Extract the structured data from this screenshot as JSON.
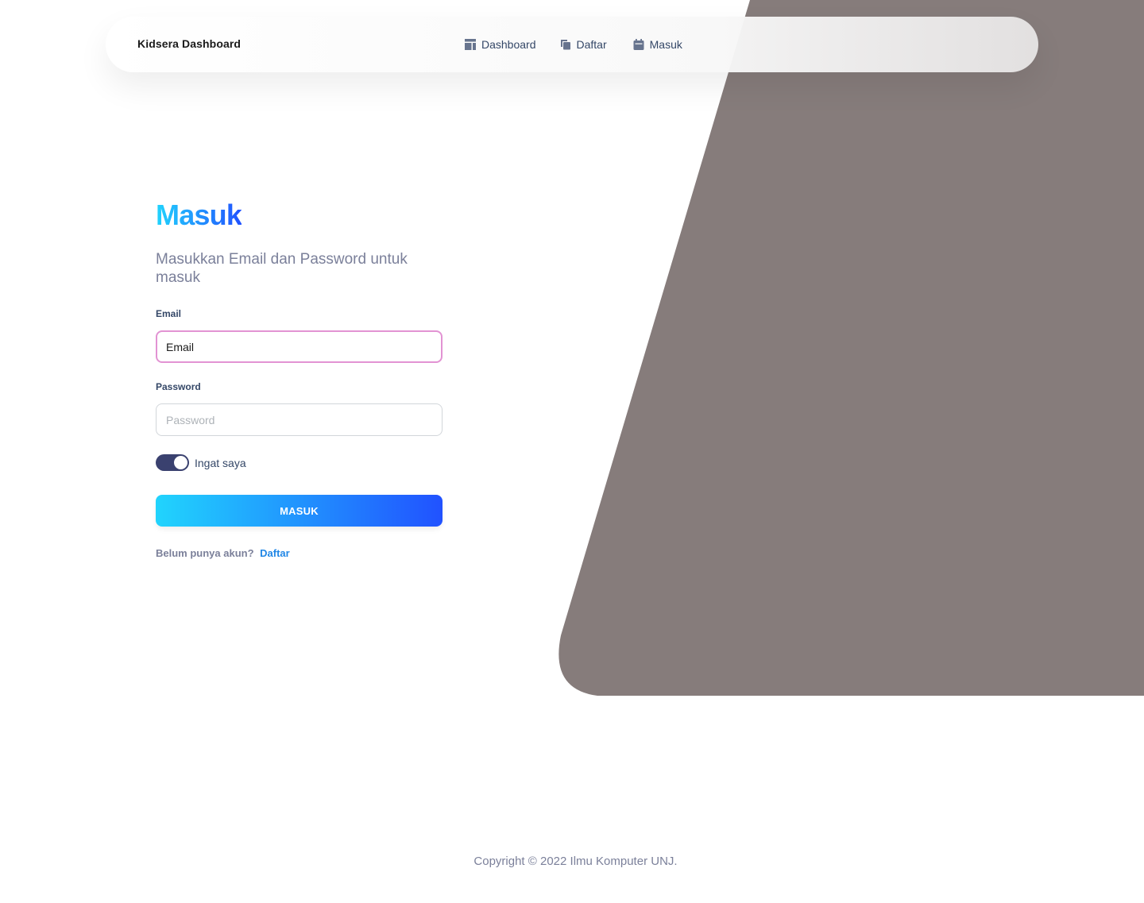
{
  "navbar": {
    "brand": "Kidsera Dashboard",
    "links": [
      {
        "label": "Dashboard",
        "icon": "dashboard-icon"
      },
      {
        "label": "Daftar",
        "icon": "copy-icon"
      },
      {
        "label": "Masuk",
        "icon": "calendar-icon"
      }
    ]
  },
  "login": {
    "title": "Masuk",
    "subtitle": "Masukkan Email dan Password untuk masuk",
    "email_label": "Email",
    "email_value": "Email",
    "password_label": "Password",
    "password_placeholder": "Password",
    "remember_label": "Ingat saya",
    "remember_checked": true,
    "submit_label": "MASUK",
    "signup_prompt": "Belum punya akun?",
    "signup_link": "Daftar"
  },
  "footer": {
    "copyright": "Copyright © 2022 Ilmu Komputer UNJ."
  },
  "colors": {
    "panel": "#867c7b",
    "gradient_start": "#21d4fd",
    "gradient_end": "#2152ff",
    "toggle_on": "#3a416f",
    "focus_border": "#e293d3",
    "link": "#2187e6"
  }
}
